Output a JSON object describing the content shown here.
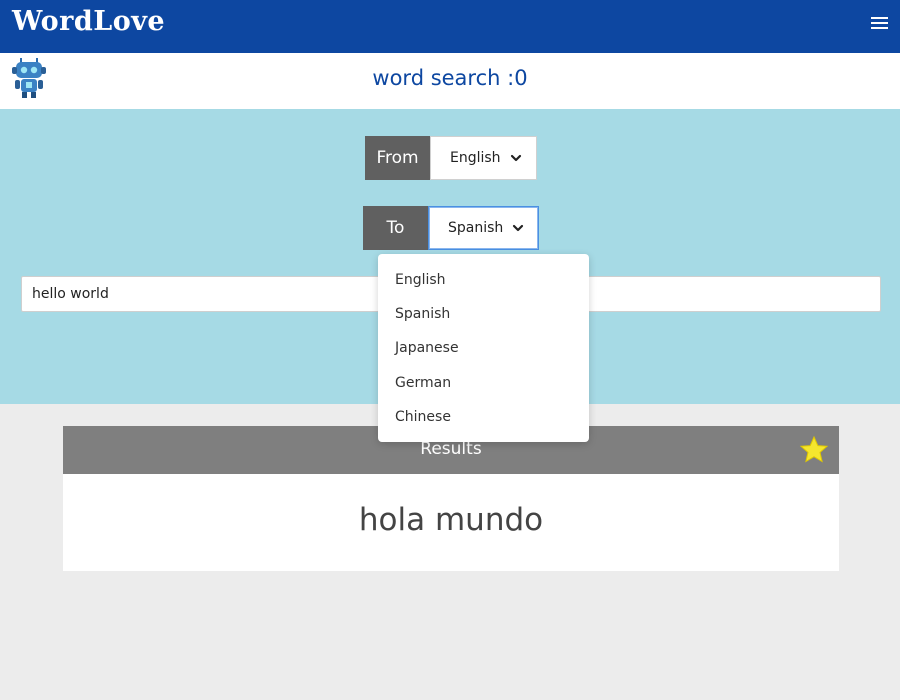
{
  "navbar": {
    "brand": "WordLove",
    "menu_icon": "hamburger-menu-icon",
    "background_color": "#0d47a1"
  },
  "header": {
    "avatar_icon": "robot-icon",
    "counter_text": "word search :0",
    "accent_color": "#0d47a1"
  },
  "form": {
    "from_label": "From",
    "from_selected": "English",
    "to_label": "To",
    "to_selected": "Spanish",
    "input_value": "hello world",
    "panel_color": "#a6dae5",
    "dropdown_open": true,
    "dropdown_options": [
      "English",
      "Spanish",
      "Japanese",
      "German",
      "Chinese"
    ]
  },
  "results": {
    "title": "Results",
    "favorite_icon": "star-icon",
    "translation": "hola mundo",
    "header_color": "#7f7f7f",
    "star_color": "#f5e62e"
  }
}
